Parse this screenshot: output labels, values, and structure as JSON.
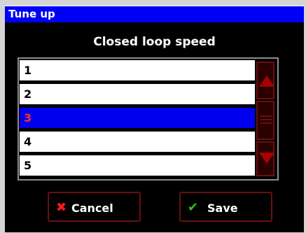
{
  "window": {
    "title": "Tune up"
  },
  "dialog": {
    "heading": "Closed loop speed"
  },
  "list": {
    "items": [
      {
        "label": "1",
        "selected": false
      },
      {
        "label": "2",
        "selected": false
      },
      {
        "label": "3",
        "selected": true
      },
      {
        "label": "4",
        "selected": false
      },
      {
        "label": "5",
        "selected": false
      }
    ]
  },
  "scrollbar": {
    "up_icon": "triangle-up-icon",
    "thumb_icon": "grip-lines-icon",
    "down_icon": "triangle-down-icon"
  },
  "buttons": {
    "cancel_icon": "✖",
    "cancel_label": "Cancel",
    "save_icon": "✔",
    "save_label": "Save"
  },
  "colors": {
    "titlebar": "#0000f4",
    "selected_row": "#0000ee",
    "selected_text": "#ff2a2a",
    "accent_red": "#a80000",
    "cancel_icon": "#ff1a1a",
    "save_icon": "#22c422"
  }
}
